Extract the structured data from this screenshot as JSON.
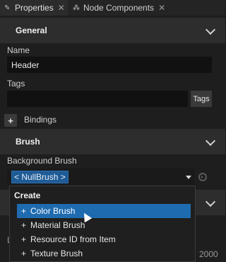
{
  "tabs": [
    {
      "label": "Properties",
      "icon": "wrench-icon",
      "close": "✕"
    },
    {
      "label": "Node Components",
      "icon": "component-icon",
      "close": "✕"
    }
  ],
  "general": {
    "title": "General",
    "name_label": "Name",
    "name_value": "Header",
    "tags_label": "Tags",
    "tags_value": "",
    "tags_button": "Tags",
    "add_button": "+",
    "bindings_label": "Bindings"
  },
  "brush": {
    "title": "Brush",
    "background_label": "Background Brush",
    "background_value": "< NullBrush >"
  },
  "dropdown": {
    "title": "Create",
    "items": [
      {
        "prefix": "+",
        "label": "Color Brush",
        "selected": true
      },
      {
        "prefix": "+",
        "label": "Material Brush",
        "selected": false
      },
      {
        "prefix": "+",
        "label": "Resource ID from Item",
        "selected": false
      },
      {
        "prefix": "+",
        "label": "Texture Brush",
        "selected": false
      }
    ]
  },
  "background": {
    "partial_label": "L",
    "partial_value": "2000"
  },
  "colors": {
    "selection": "#1f6bb0",
    "section_header": "#2d2d2d",
    "panel": "#1e1e1e"
  }
}
